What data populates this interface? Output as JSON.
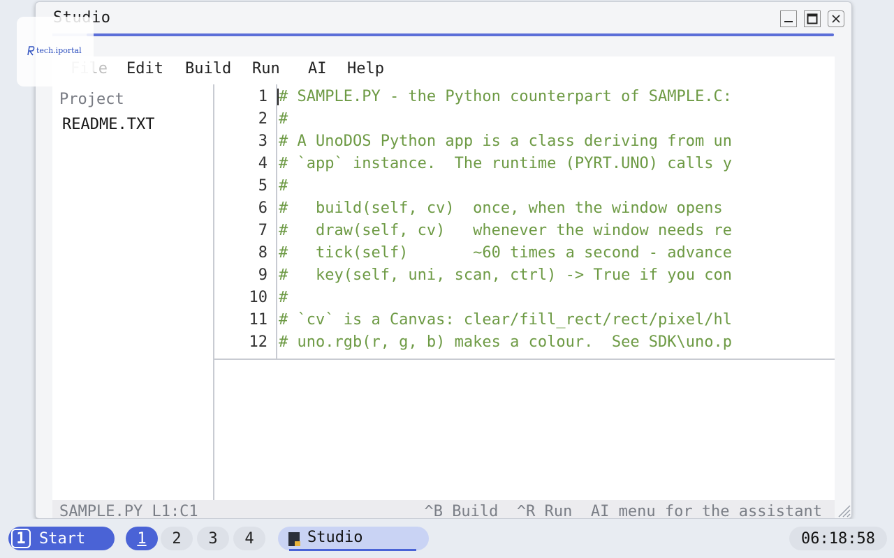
{
  "window": {
    "title": "Studio"
  },
  "menu": {
    "items": [
      "File",
      "Edit",
      "Build",
      "Run",
      "AI",
      "Help"
    ]
  },
  "sidebar": {
    "heading": "Project",
    "files": [
      "README.TXT"
    ]
  },
  "editor": {
    "lines": [
      {
        "num": "1",
        "text": "# SAMPLE.PY - the Python counterpart of SAMPLE.C:"
      },
      {
        "num": "2",
        "text": "#"
      },
      {
        "num": "3",
        "text": "# A UnoDOS Python app is a class deriving from un"
      },
      {
        "num": "4",
        "text": "# `app` instance.  The runtime (PYRT.UNO) calls y"
      },
      {
        "num": "5",
        "text": "#"
      },
      {
        "num": "6",
        "text": "#   build(self, cv)  once, when the window opens"
      },
      {
        "num": "7",
        "text": "#   draw(self, cv)   whenever the window needs re"
      },
      {
        "num": "8",
        "text": "#   tick(self)       ~60 times a second - advance"
      },
      {
        "num": "9",
        "text": "#   key(self, uni, scan, ctrl) -> True if you con"
      },
      {
        "num": "10",
        "text": "#"
      },
      {
        "num": "11",
        "text": "# `cv` is a Canvas: clear/fill_rect/rect/pixel/hl"
      },
      {
        "num": "12",
        "text": "# uno.rgb(r, g, b) makes a colour.  See SDK\\uno.p"
      }
    ],
    "code_color": "#6d9a44"
  },
  "status": {
    "left": "SAMPLE.PY L1:C1",
    "right": "^B Build  ^R Run  AI menu for the assistant"
  },
  "taskbar": {
    "start_badge": "1",
    "start_label": "Start",
    "workspaces": [
      "1",
      "2",
      "3",
      "4"
    ],
    "active_workspace": "1",
    "task_label": "Studio",
    "clock": "06:18:58"
  },
  "watermark": {
    "text": "tech.iportal"
  },
  "colors": {
    "accent": "#4a63d6",
    "background": "#e8ecf2"
  }
}
